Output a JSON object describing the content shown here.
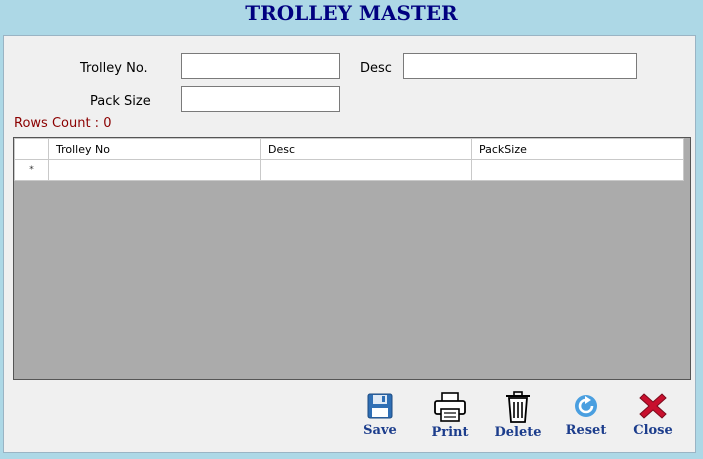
{
  "window": {
    "title": "TROLLEY MASTER"
  },
  "form": {
    "trolley_no_label": "Trolley No.",
    "trolley_no_value": "",
    "desc_label": "Desc",
    "desc_value": "",
    "pack_size_label": "Pack Size",
    "pack_size_value": ""
  },
  "rows_count": "Rows Count : 0",
  "grid": {
    "columns": [
      "Trolley No",
      "Desc",
      "PackSize"
    ],
    "new_row_marker": "*",
    "rows": []
  },
  "toolbar": {
    "save": {
      "label": "Save",
      "icon": "floppy-disk-icon"
    },
    "print": {
      "label": "Print",
      "icon": "printer-icon"
    },
    "delete": {
      "label": "Delete",
      "icon": "trash-icon"
    },
    "reset": {
      "label": "Reset",
      "icon": "refresh-icon"
    },
    "close": {
      "label": "Close",
      "icon": "close-x-icon"
    }
  },
  "colors": {
    "background": "#add8e6",
    "title": "#000080",
    "rows_count": "#8b0000",
    "button_label": "#1c3d8c",
    "grid_empty": "#ababab"
  }
}
